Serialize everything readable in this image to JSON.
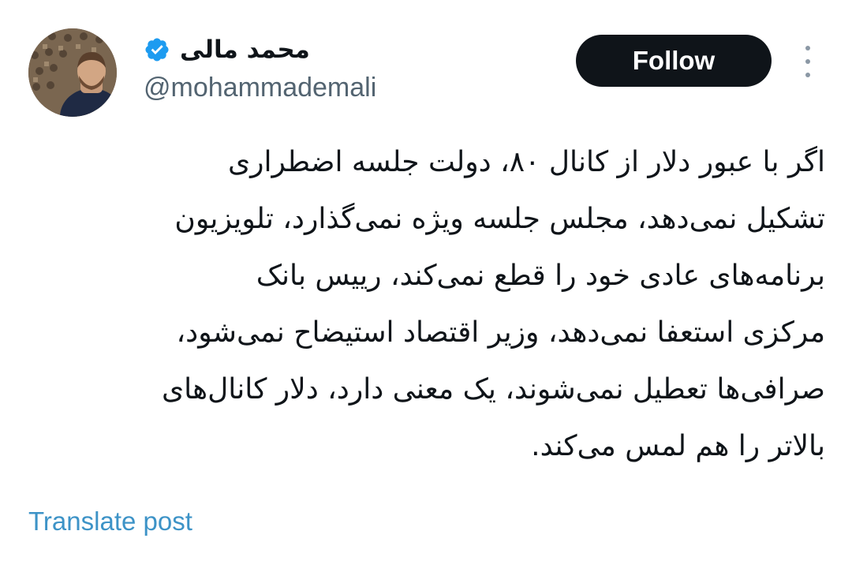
{
  "author": {
    "display_name": "محمد مالی",
    "handle": "@mohammademali",
    "verified": true,
    "avatar_icon": "profile-photo"
  },
  "actions": {
    "follow_label": "Follow",
    "more_icon": "more-vertical-icon"
  },
  "tweet": {
    "lines": [
      "اگر با عبور دلار از کانال ۸۰، دولت جلسه اضطراری",
      "تشکیل نمی‌دهد، مجلس جلسه ویژه نمی‌گذارد، تلویزیون",
      "برنامه‌های عادی خود را قطع نمی‌کند، رییس بانک",
      "مرکزی استعفا نمی‌دهد، وزیر اقتصاد استیضاح نمی‌شود،",
      "صرافی‌ها تعطیل نمی‌شوند، یک معنی دارد، دلار کانال‌های",
      "بالاتر را هم لمس می‌کند."
    ]
  },
  "footer": {
    "translate_label": "Translate post"
  },
  "colors": {
    "text": "#0f1419",
    "secondary_text": "#536471",
    "link": "#3d93c7",
    "verified_badge": "#1d9bf0",
    "follow_bg": "#0f1419"
  }
}
